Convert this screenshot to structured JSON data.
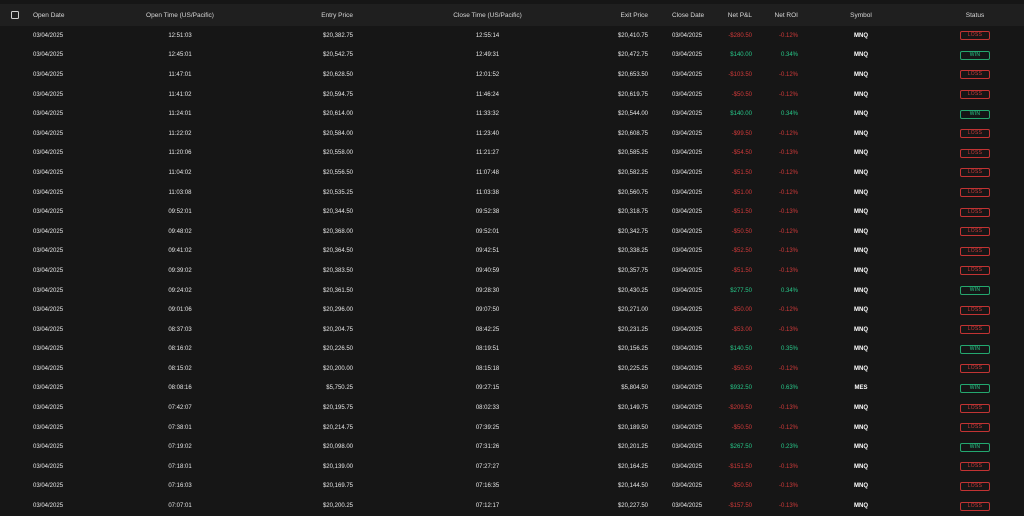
{
  "columns": {
    "open_date": "Open Date",
    "open_time": "Open Time (US/Pacific)",
    "entry_price": "Entry Price",
    "close_time": "Close Time (US/Pacific)",
    "exit_price": "Exit Price",
    "close_date": "Close Date",
    "net_pnl": "Net P&L",
    "net_roi": "Net ROI",
    "symbol": "Symbol",
    "status": "Status"
  },
  "colors": {
    "win": "#27c98a",
    "loss": "#d23a3a",
    "background": "#161616",
    "header": "#1f1f1f"
  },
  "rows": [
    {
      "open_date": "03/04/2025",
      "open_time": "12:51:03",
      "entry_price": "$20,382.75",
      "close_time": "12:55:14",
      "exit_price": "$20,410.75",
      "close_date": "03/04/2025",
      "net_pnl": "-$280.50",
      "net_roi": "-0.12%",
      "symbol": "MNQ",
      "status": "LOSS"
    },
    {
      "open_date": "03/04/2025",
      "open_time": "12:45:01",
      "entry_price": "$20,542.75",
      "close_time": "12:49:31",
      "exit_price": "$20,472.75",
      "close_date": "03/04/2025",
      "net_pnl": "$140.00",
      "net_roi": "0.34%",
      "symbol": "MNQ",
      "status": "WIN"
    },
    {
      "open_date": "03/04/2025",
      "open_time": "11:47:01",
      "entry_price": "$20,628.50",
      "close_time": "12:01:52",
      "exit_price": "$20,653.50",
      "close_date": "03/04/2025",
      "net_pnl": "-$103.50",
      "net_roi": "-0.12%",
      "symbol": "MNQ",
      "status": "LOSS"
    },
    {
      "open_date": "03/04/2025",
      "open_time": "11:41:02",
      "entry_price": "$20,594.75",
      "close_time": "11:46:24",
      "exit_price": "$20,619.75",
      "close_date": "03/04/2025",
      "net_pnl": "-$50.50",
      "net_roi": "-0.12%",
      "symbol": "MNQ",
      "status": "LOSS"
    },
    {
      "open_date": "03/04/2025",
      "open_time": "11:24:01",
      "entry_price": "$20,614.00",
      "close_time": "11:33:32",
      "exit_price": "$20,544.00",
      "close_date": "03/04/2025",
      "net_pnl": "$140.00",
      "net_roi": "0.34%",
      "symbol": "MNQ",
      "status": "WIN"
    },
    {
      "open_date": "03/04/2025",
      "open_time": "11:22:02",
      "entry_price": "$20,584.00",
      "close_time": "11:23:40",
      "exit_price": "$20,608.75",
      "close_date": "03/04/2025",
      "net_pnl": "-$99.50",
      "net_roi": "-0.12%",
      "symbol": "MNQ",
      "status": "LOSS"
    },
    {
      "open_date": "03/04/2025",
      "open_time": "11:20:06",
      "entry_price": "$20,558.00",
      "close_time": "11:21:27",
      "exit_price": "$20,585.25",
      "close_date": "03/04/2025",
      "net_pnl": "-$54.50",
      "net_roi": "-0.13%",
      "symbol": "MNQ",
      "status": "LOSS"
    },
    {
      "open_date": "03/04/2025",
      "open_time": "11:04:02",
      "entry_price": "$20,556.50",
      "close_time": "11:07:48",
      "exit_price": "$20,582.25",
      "close_date": "03/04/2025",
      "net_pnl": "-$51.50",
      "net_roi": "-0.12%",
      "symbol": "MNQ",
      "status": "LOSS"
    },
    {
      "open_date": "03/04/2025",
      "open_time": "11:03:08",
      "entry_price": "$20,535.25",
      "close_time": "11:03:38",
      "exit_price": "$20,560.75",
      "close_date": "03/04/2025",
      "net_pnl": "-$51.00",
      "net_roi": "-0.12%",
      "symbol": "MNQ",
      "status": "LOSS"
    },
    {
      "open_date": "03/04/2025",
      "open_time": "09:52:01",
      "entry_price": "$20,344.50",
      "close_time": "09:52:38",
      "exit_price": "$20,318.75",
      "close_date": "03/04/2025",
      "net_pnl": "-$51.50",
      "net_roi": "-0.13%",
      "symbol": "MNQ",
      "status": "LOSS"
    },
    {
      "open_date": "03/04/2025",
      "open_time": "09:48:02",
      "entry_price": "$20,368.00",
      "close_time": "09:52:01",
      "exit_price": "$20,342.75",
      "close_date": "03/04/2025",
      "net_pnl": "-$50.50",
      "net_roi": "-0.12%",
      "symbol": "MNQ",
      "status": "LOSS"
    },
    {
      "open_date": "03/04/2025",
      "open_time": "09:41:02",
      "entry_price": "$20,364.50",
      "close_time": "09:42:51",
      "exit_price": "$20,338.25",
      "close_date": "03/04/2025",
      "net_pnl": "-$52.50",
      "net_roi": "-0.13%",
      "symbol": "MNQ",
      "status": "LOSS"
    },
    {
      "open_date": "03/04/2025",
      "open_time": "09:39:02",
      "entry_price": "$20,383.50",
      "close_time": "09:40:59",
      "exit_price": "$20,357.75",
      "close_date": "03/04/2025",
      "net_pnl": "-$51.50",
      "net_roi": "-0.13%",
      "symbol": "MNQ",
      "status": "LOSS"
    },
    {
      "open_date": "03/04/2025",
      "open_time": "09:24:02",
      "entry_price": "$20,361.50",
      "close_time": "09:28:30",
      "exit_price": "$20,430.25",
      "close_date": "03/04/2025",
      "net_pnl": "$277.50",
      "net_roi": "0.34%",
      "symbol": "MNQ",
      "status": "WIN"
    },
    {
      "open_date": "03/04/2025",
      "open_time": "09:01:06",
      "entry_price": "$20,296.00",
      "close_time": "09:07:50",
      "exit_price": "$20,271.00",
      "close_date": "03/04/2025",
      "net_pnl": "-$50.00",
      "net_roi": "-0.12%",
      "symbol": "MNQ",
      "status": "LOSS"
    },
    {
      "open_date": "03/04/2025",
      "open_time": "08:37:03",
      "entry_price": "$20,204.75",
      "close_time": "08:42:25",
      "exit_price": "$20,231.25",
      "close_date": "03/04/2025",
      "net_pnl": "-$53.00",
      "net_roi": "-0.13%",
      "symbol": "MNQ",
      "status": "LOSS"
    },
    {
      "open_date": "03/04/2025",
      "open_time": "08:16:02",
      "entry_price": "$20,226.50",
      "close_time": "08:19:51",
      "exit_price": "$20,156.25",
      "close_date": "03/04/2025",
      "net_pnl": "$140.50",
      "net_roi": "0.35%",
      "symbol": "MNQ",
      "status": "WIN"
    },
    {
      "open_date": "03/04/2025",
      "open_time": "08:15:02",
      "entry_price": "$20,200.00",
      "close_time": "08:15:18",
      "exit_price": "$20,225.25",
      "close_date": "03/04/2025",
      "net_pnl": "-$50.50",
      "net_roi": "-0.12%",
      "symbol": "MNQ",
      "status": "LOSS"
    },
    {
      "open_date": "03/04/2025",
      "open_time": "08:08:16",
      "entry_price": "$5,750.25",
      "close_time": "09:27:15",
      "exit_price": "$5,804.50",
      "close_date": "03/04/2025",
      "net_pnl": "$932.50",
      "net_roi": "0.63%",
      "symbol": "MES",
      "status": "WIN"
    },
    {
      "open_date": "03/04/2025",
      "open_time": "07:42:07",
      "entry_price": "$20,195.75",
      "close_time": "08:02:33",
      "exit_price": "$20,149.75",
      "close_date": "03/04/2025",
      "net_pnl": "-$209.50",
      "net_roi": "-0.13%",
      "symbol": "MNQ",
      "status": "LOSS"
    },
    {
      "open_date": "03/04/2025",
      "open_time": "07:38:01",
      "entry_price": "$20,214.75",
      "close_time": "07:39:25",
      "exit_price": "$20,189.50",
      "close_date": "03/04/2025",
      "net_pnl": "-$50.50",
      "net_roi": "-0.12%",
      "symbol": "MNQ",
      "status": "LOSS"
    },
    {
      "open_date": "03/04/2025",
      "open_time": "07:19:02",
      "entry_price": "$20,098.00",
      "close_time": "07:31:26",
      "exit_price": "$20,201.25",
      "close_date": "03/04/2025",
      "net_pnl": "$267.50",
      "net_roi": "0.23%",
      "symbol": "MNQ",
      "status": "WIN"
    },
    {
      "open_date": "03/04/2025",
      "open_time": "07:18:01",
      "entry_price": "$20,139.00",
      "close_time": "07:27:27",
      "exit_price": "$20,164.25",
      "close_date": "03/04/2025",
      "net_pnl": "-$151.50",
      "net_roi": "-0.13%",
      "symbol": "MNQ",
      "status": "LOSS"
    },
    {
      "open_date": "03/04/2025",
      "open_time": "07:16:03",
      "entry_price": "$20,169.75",
      "close_time": "07:16:35",
      "exit_price": "$20,144.50",
      "close_date": "03/04/2025",
      "net_pnl": "-$50.50",
      "net_roi": "-0.13%",
      "symbol": "MNQ",
      "status": "LOSS"
    },
    {
      "open_date": "03/04/2025",
      "open_time": "07:07:01",
      "entry_price": "$20,200.25",
      "close_time": "07:12:17",
      "exit_price": "$20,227.50",
      "close_date": "03/04/2025",
      "net_pnl": "-$157.50",
      "net_roi": "-0.13%",
      "symbol": "MNQ",
      "status": "LOSS"
    }
  ]
}
